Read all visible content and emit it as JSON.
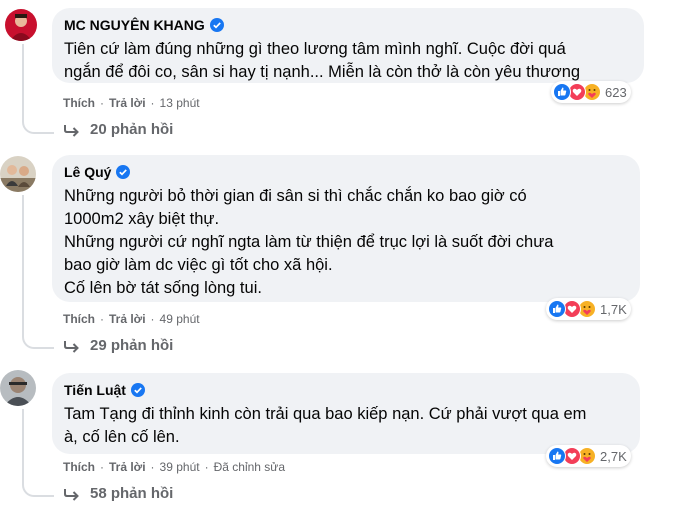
{
  "comments": [
    {
      "author": "MC NGUYÊN KHANG",
      "verified": true,
      "lines": [
        "Tiên cứ làm đúng những gì theo lương tâm mình nghĩ. Cuộc đời quá",
        "ngắn để đôi co, sân si hay tị nạnh... Miễn là còn thở là còn yêu thương"
      ],
      "like_label": "Thích",
      "reply_label": "Trả lời",
      "time": "13 phút",
      "edited": "",
      "reaction_count": "623",
      "reactions": [
        "like-icon",
        "love-icon",
        "care-icon"
      ],
      "replies": "20 phản hồi"
    },
    {
      "author": "Lê Quý",
      "verified": true,
      "lines": [
        "Những người bỏ thời gian đi sân si thì chắc chắn ko bao giờ có",
        "1000m2 xây biệt thự.",
        "Những người cứ nghĩ ngta làm từ thiện để trục lợi là suốt đời chưa",
        "bao giờ làm dc việc gì tốt cho xã hội.",
        "Cố lên bờ tát sống lòng tui."
      ],
      "like_label": "Thích",
      "reply_label": "Trả lời",
      "time": "49 phút",
      "edited": "",
      "reaction_count": "1,7K",
      "reactions": [
        "like-icon",
        "love-icon",
        "care-icon"
      ],
      "replies": "29 phản hồi"
    },
    {
      "author": "Tiến Luật",
      "verified": true,
      "lines": [
        "Tam Tạng đi thỉnh kinh còn trải qua bao kiếp nạn. Cứ phải vượt qua em",
        "à, cố lên cố lên."
      ],
      "like_label": "Thích",
      "reply_label": "Trả lời",
      "time": "39 phút",
      "edited": "Đã chỉnh sửa",
      "reaction_count": "2,7K",
      "reactions": [
        "like-icon",
        "love-icon",
        "care-icon"
      ],
      "replies": "58 phản hồi"
    }
  ],
  "colors": {
    "bubble": "#f0f2f5",
    "verified": "#1877f2",
    "meta_text": "#65676b",
    "like": "#1877f2",
    "love": "#f33e58",
    "care": "#f7b125"
  }
}
